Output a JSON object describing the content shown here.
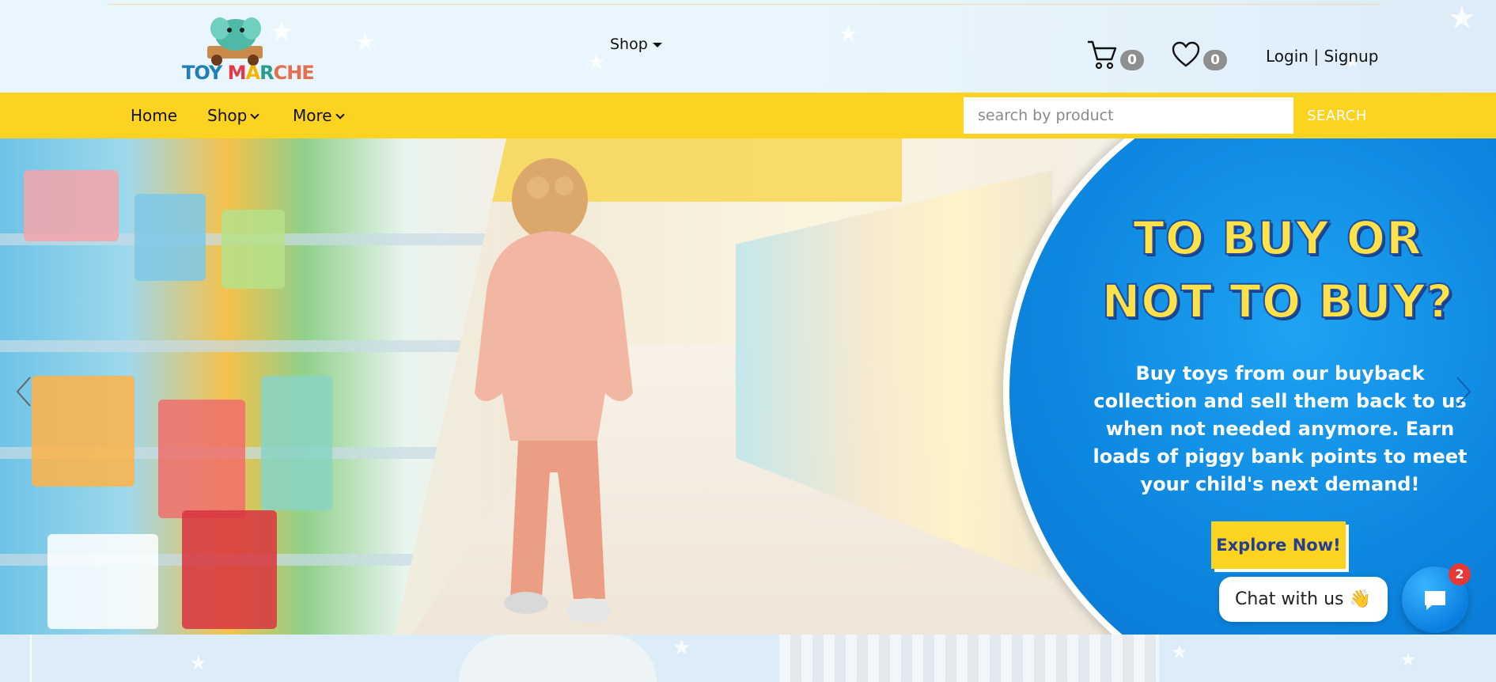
{
  "brand": {
    "logo_text": [
      "TOY ",
      "M",
      "A",
      "R",
      "CHE"
    ],
    "logo_name": "elephant-logo-icon"
  },
  "header": {
    "shop_label": "Shop",
    "cart_count": "0",
    "wishlist_count": "0",
    "login_label": "Login",
    "separator": "|",
    "signup_label": "Signup"
  },
  "nav": {
    "items": [
      {
        "label": "Home"
      },
      {
        "label": "Shop"
      },
      {
        "label": "More"
      }
    ],
    "search_placeholder": "search by product",
    "search_button": "SEARCH"
  },
  "hero": {
    "title_line1": "TO BUY OR",
    "title_line2": "NOT TO BUY?",
    "body": "Buy toys from our buyback collection and sell them back to us when not needed anymore. Earn loads of piggy bank points to meet your child's next demand!",
    "cta": "Explore Now!"
  },
  "chat": {
    "label": "Chat with us",
    "emoji": "👋",
    "unread": "2"
  },
  "colors": {
    "nav_yellow": "#fdd321",
    "promo_blue": "#0d88e0",
    "title_yellow": "#ffe24a",
    "badge_grey": "#8f8f8f",
    "notify_red": "#e53935"
  }
}
